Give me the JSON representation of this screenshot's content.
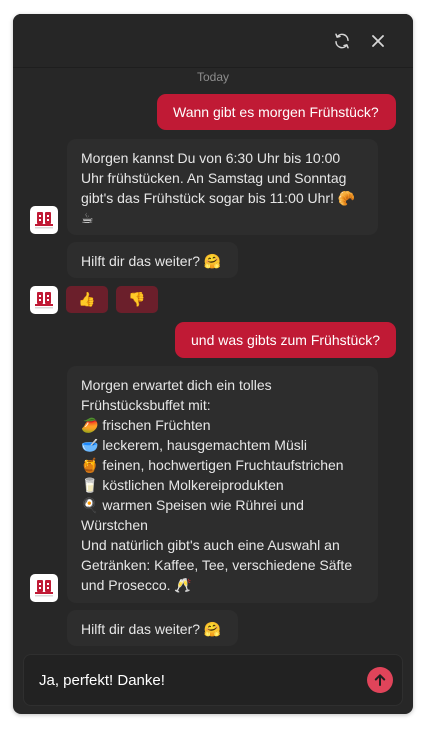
{
  "header": {
    "refresh_icon": "refresh-icon",
    "close_icon": "close-icon"
  },
  "day_label": "Today",
  "messages": [
    {
      "role": "user",
      "text": "Wann gibt es morgen Frühstück?"
    },
    {
      "role": "bot",
      "text": "Morgen kannst Du von 6:30 Uhr bis 10:00\nUhr frühstücken. An Samstag und Sonntag\ngibt's das Frühstück sogar bis 11:00 Uhr! 🥐\n☕"
    },
    {
      "role": "bot",
      "text": "Hilft dir das weiter? 🤗"
    },
    {
      "role": "user",
      "text": "und was gibts zum Frühstück?"
    },
    {
      "role": "bot",
      "text": "Morgen erwartet dich ein tolles\nFrühstücksbuffet mit:\n🥭 frischen Früchten\n🥣 leckerem, hausgemachtem Müsli\n🍯 feinen, hochwertigen Fruchtaufstrichen\n🥛 köstlichen Molkereiprodukten\n🍳 warmen Speisen wie Rührei und\nWürstchen\nUnd natürlich gibt's auch eine Auswahl an\nGetränken: Kaffee, Tee, verschiedene Säfte\nund Prosecco. 🥂"
    },
    {
      "role": "bot",
      "text": "Hilft dir das weiter? 🤗"
    }
  ],
  "reactions": {
    "thumbs_up": "👍",
    "thumbs_down": "👎"
  },
  "input": {
    "value": "Ja, perfekt! Danke!",
    "placeholder": ""
  },
  "colors": {
    "accent": "#c01a35",
    "send": "#e0445a",
    "reaction_bg": "#6b1f2b",
    "panel": "#272727",
    "bot_bubble": "#2d2d2d"
  }
}
